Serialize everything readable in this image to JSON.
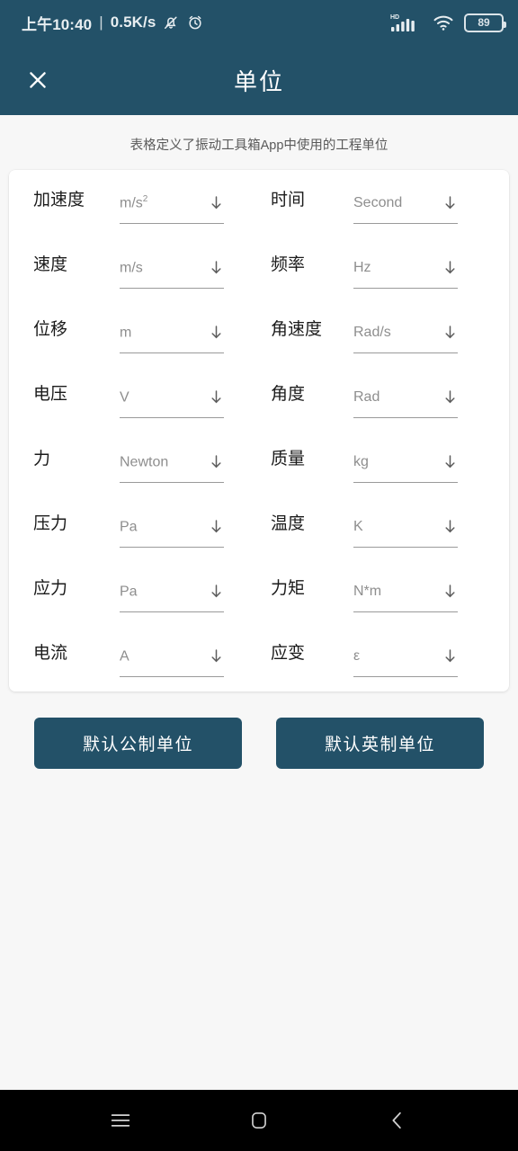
{
  "statusbar": {
    "time": "上午10:40",
    "separator": "|",
    "network_speed": "0.5K/s",
    "icons": [
      "bell-muted-icon",
      "alarm-icon",
      "hd-signal-icon",
      "wifi-icon",
      "battery-icon"
    ],
    "battery_level": "89",
    "hd_label": "HD"
  },
  "appbar": {
    "title": "单位",
    "close_icon": "close-icon"
  },
  "subtitle": "表格定义了振动工具箱App中使用的工程单位",
  "units": {
    "rows": [
      {
        "left_label": "加速度",
        "left_value": "m/s",
        "left_sup": "2",
        "right_label": "时间",
        "right_value": "Second"
      },
      {
        "left_label": "速度",
        "left_value": "m/s",
        "left_sup": "",
        "right_label": "频率",
        "right_value": "Hz"
      },
      {
        "left_label": "位移",
        "left_value": "m",
        "left_sup": "",
        "right_label": "角速度",
        "right_value": "Rad/s"
      },
      {
        "left_label": "电压",
        "left_value": "V",
        "left_sup": "",
        "right_label": "角度",
        "right_value": "Rad"
      },
      {
        "left_label": "力",
        "left_value": "Newton",
        "left_sup": "",
        "right_label": "质量",
        "right_value": "kg"
      },
      {
        "left_label": "压力",
        "left_value": "Pa",
        "left_sup": "",
        "right_label": "温度",
        "right_value": "K"
      },
      {
        "left_label": "应力",
        "left_value": "Pa",
        "left_sup": "",
        "right_label": "力矩",
        "right_value": "N*m"
      },
      {
        "left_label": "电流",
        "left_value": "A",
        "left_sup": "",
        "right_label": "应变",
        "right_value": "ε"
      }
    ],
    "dropdown_icon": "arrow-down-icon"
  },
  "buttons": {
    "metric": "默认公制单位",
    "imperial": "默认英制单位"
  },
  "navbar": {
    "recents": "recents-icon",
    "home": "home-icon",
    "back": "back-icon"
  },
  "colors": {
    "accent": "#235168",
    "page_bg": "#f7f7f7",
    "card_bg": "#ffffff",
    "label_text": "#1b1b1b",
    "value_text": "#8e8e8e",
    "navbar_bg": "#000000"
  }
}
